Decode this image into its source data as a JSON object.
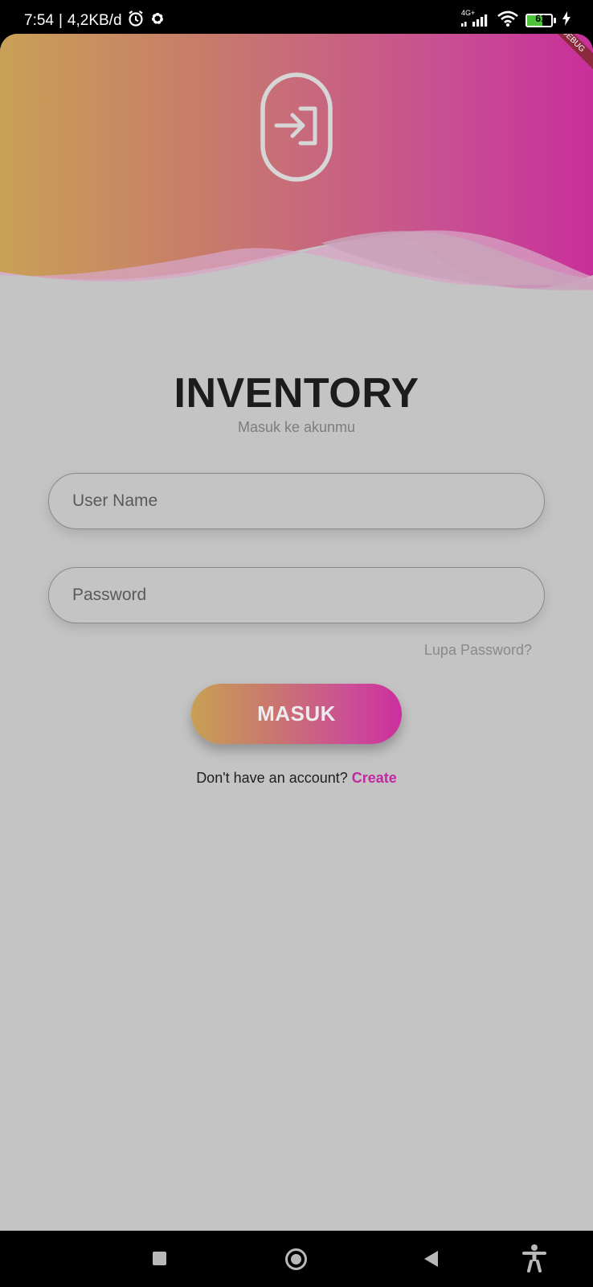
{
  "status_bar": {
    "time": "7:54",
    "separator": "|",
    "net_speed": "4,2KB/d",
    "icons": [
      "alarm-icon",
      "settings-icon",
      "signal-4g-icon",
      "wifi-icon",
      "battery-icon",
      "charging-icon"
    ],
    "network_label": "4G+",
    "battery_level": "61"
  },
  "header": {
    "icon": "login-door-icon",
    "gradient": [
      "#c9a055",
      "#c77b6b",
      "#c84f93",
      "#c82f9a"
    ],
    "debug_banner": "DEBUG"
  },
  "login": {
    "title": "INVENTORY",
    "subtitle": "Masuk ke akunmu",
    "username_placeholder": "User Name",
    "username_value": "",
    "password_placeholder": "Password",
    "password_value": "",
    "forgot_label": "Lupa Password?",
    "submit_label": "MASUK",
    "signup_prompt": "Don't have an account?",
    "signup_link": "Create"
  },
  "colors": {
    "background": "#c4c4c4",
    "accent": "#c02aa0",
    "gradient_start": "#c7a054",
    "gradient_end": "#cc2f9e"
  },
  "nav_bar": {
    "icons": [
      "recents-icon",
      "home-icon",
      "back-icon",
      "accessibility-icon"
    ]
  }
}
